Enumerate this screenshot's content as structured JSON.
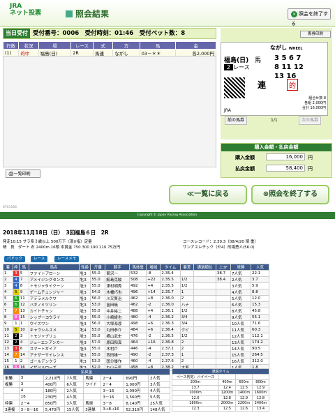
{
  "header": {
    "logo_line1": "JRA",
    "logo_line2": "ネット投票",
    "title": "照会結果",
    "end_label": "照会を終了する"
  },
  "status": {
    "tag": "当日受付",
    "text": "受付番号：0006　受付時刻：01:46　受付ベット数：8"
  },
  "table": {
    "headers": [
      "行数",
      "状況",
      "場",
      "名",
      "レース",
      "式",
      "別",
      "方",
      "式",
      "馬",
      "組",
      "金",
      "額"
    ],
    "row": {
      "num": "(1)",
      "status": "的中",
      "venue": "福島(日)",
      "race": "2R",
      "type": "馬連",
      "method": "ながし",
      "combo": "03－＊＊",
      "amount": "各2,000円"
    }
  },
  "print_link": "一覧印刷",
  "ticket": {
    "print": "馬券印刷",
    "venue": "福島",
    "day": "(日)",
    "race": "2",
    "race_label": "レース",
    "type": "ながし",
    "wheel": "WHEEL",
    "box_label": "馬",
    "nums": [
      "3",
      "5",
      "6",
      "7",
      "8",
      "11",
      "12",
      "13",
      "16"
    ],
    "ren": "連",
    "qr": "的",
    "jra": "JRA",
    "total_label": "組合せ数",
    "total": "8",
    "each": "各組",
    "each_amount": "2,000円",
    "sum_label": "合計",
    "sum_amount": "16,000円"
  },
  "nav": {
    "prev": "前の馬券",
    "page": "1/1",
    "next": "次の馬券"
  },
  "summary": {
    "title": "購入金額・払戻金額",
    "buy_label": "購入金額",
    "buy": "16,000",
    "pay_label": "払戻金額",
    "pay": "58,400",
    "unit": "円"
  },
  "back_label": "一覧に戻る",
  "end_label2": "照会を終了する",
  "copyright": "Copyright © Japan Racing Association.",
  "docnum": "0701504",
  "result": {
    "date": "2018年11月18日（日）　3回福島６日　2R",
    "meta1": "発走10:15 サラ系３歳以上 500万下（混)(指）定量",
    "meta2": "晴　良　ダート 右 2400m 16頭 本賞金 750 300 190 110 75万円",
    "course": "コースレコード：2.30.3（08/4/20 晴 重）",
    "record": "サンアスレチック（セ4）的場勇人(56.0)",
    "btns": [
      "パドック",
      "レース",
      "レースメモ"
    ],
    "headers": [
      "着",
      "枠",
      "馬",
      "馬名",
      "性齢",
      "斤量",
      "騎手",
      "馬体重",
      "増減",
      "タイム",
      "着差",
      "通過順位",
      "上3F",
      "単勝",
      "人気"
    ],
    "rows": [
      [
        "1",
        "3",
        "5",
        "ファイトアローン",
        "牡3",
        "55.0",
        "菊沢一",
        "532",
        "-8",
        "2.35.4",
        "",
        "",
        "38.7",
        "7人気",
        "22.1"
      ],
      [
        "2",
        "4",
        "7",
        "アメイジングセンス",
        "牝3",
        "55.0",
        "鮫島克駿",
        "508",
        "+22",
        "2.35.5",
        "1/2",
        "",
        "38.4",
        "2人気",
        "3.7"
      ],
      [
        "3",
        "4",
        "8",
        "トモジャタイクーン",
        "牡3",
        "55.0",
        "津村明秀",
        "492",
        "+4",
        "2.35.5",
        "1/2",
        "",
        "",
        "3人気",
        "5.9"
      ],
      [
        "4",
        "5",
        "9",
        "ゲームチェンジャー",
        "牡3",
        "54.0",
        "木幡巧也",
        "496",
        "+14",
        "2.35.7",
        "1",
        "",
        "",
        "4人気",
        "8.8"
      ],
      [
        "5",
        "6",
        "11",
        "アデラメルクワ",
        "牡3",
        "56.0",
        "川又賢治",
        "462",
        "+8",
        "2.36.0",
        "2",
        "",
        "",
        "5人気",
        "12.0"
      ],
      [
        "6",
        "6",
        "12",
        "ハギノミツリン",
        "牝3",
        "53.0",
        "富田暁",
        "462",
        "-2",
        "2.36.0",
        "ハナ",
        "",
        "",
        "6人気",
        "15.3"
      ],
      [
        "7",
        "7",
        "13",
        "カイトチャン",
        "牡3",
        "55.0",
        "中井裕二",
        "488",
        "+4",
        "2.36.1",
        "1/2",
        "",
        "",
        "8人気",
        "45.8"
      ],
      [
        "8",
        "8",
        "15",
        "シップーコウライ",
        "牡3",
        "55.0",
        "小崎綾也",
        "480",
        "-4",
        "2.36.2",
        "3/4",
        "",
        "",
        "9人気",
        "55.1"
      ],
      [
        "9",
        "1",
        "1",
        "ウイズワン",
        "牡3",
        "56.0",
        "大塚海渡",
        "498",
        "+6",
        "2.36.3",
        "3/4",
        "",
        "",
        "10人気",
        "71.6"
      ],
      [
        "10",
        "5",
        "10",
        "キャウシルスメ",
        "牝4",
        "53.0",
        "丸田恭介",
        "484",
        "+6",
        "2.36.4",
        "クビ",
        "",
        "",
        "11人気",
        "60.3"
      ],
      [
        "11",
        "2",
        "3",
        "トモジャプリュ",
        "牡3",
        "55.0",
        "横山武史",
        "476",
        "-2",
        "2.36.5",
        "1/2",
        "",
        "",
        "12人気",
        "112.1"
      ],
      [
        "12",
        "2",
        "4",
        "ジューエンアンカー",
        "牡3",
        "57.0",
        "原田和真",
        "464",
        "+16",
        "2.36.8",
        "2",
        "",
        "",
        "13人気",
        "174.2"
      ],
      [
        "13",
        "3",
        "6",
        "スマートガイア",
        "牡3",
        "55.0",
        "木村戸",
        "446",
        "-4",
        "2.37.1",
        "2",
        "",
        "",
        "14人気",
        "90.5"
      ],
      [
        "14",
        "7",
        "14",
        "アナザーサイレンス",
        "牡3",
        "55.0",
        "西田雄一",
        "490",
        "-2",
        "2.37.3",
        "1",
        "",
        "",
        "15人気",
        "264.5"
      ],
      [
        "15",
        "1",
        "2",
        "ゴールデンクラ",
        "牝3",
        "53.0",
        "国分優作",
        "460",
        "-4",
        "2.37.6",
        "2",
        "",
        "",
        "16人気",
        "312.0"
      ],
      [
        "16",
        "8",
        "16",
        "イザベルローズ",
        "牝3",
        "52.0",
        "丸山元気",
        "458",
        "+8",
        "2.38.2",
        "大差",
        "",
        "",
        "1人気",
        "1.8"
      ]
    ],
    "payout_title": "払戻金",
    "lap_title": "通過タイム",
    "payout": [
      [
        "単勝",
        "3",
        "2,210円",
        "7人気",
        "馬連",
        "2－4",
        "690円",
        "2人気"
      ],
      [
        "複勝",
        "3",
        "400円",
        "6人気",
        "ワイド",
        "2－4",
        "1,000円",
        "3人気"
      ],
      [
        "",
        "4",
        "180円",
        "2人気",
        "",
        "3－16",
        "1,090円",
        "4人気"
      ],
      [
        "",
        "16",
        "230円",
        "4人気",
        "",
        "3－16",
        "1,560円",
        "5人気"
      ],
      [
        "枠連",
        "2－4",
        "850円",
        "3人気",
        "馬単",
        "3－8",
        "8,140円",
        "25人気"
      ],
      [
        "3連複",
        "3－8－16",
        "5,470円",
        "15人気",
        "3連単",
        "3→8→16",
        "52,310円",
        "148人気"
      ]
    ],
    "lap": [
      [
        "ペース判定：ハイペース",
        "",
        "",
        ""
      ],
      [
        "200m",
        "400m",
        "600m",
        "800m"
      ],
      [
        "13.7",
        "12.4",
        "12.5",
        "12.9"
      ],
      [
        "1000m",
        "1200m",
        "1400m",
        "1600m"
      ],
      [
        "12.6",
        "12.8",
        "12.9",
        "12.8"
      ],
      [
        "1800m",
        "2000m",
        "2200m",
        "2400m"
      ],
      [
        "12.3",
        "12.5",
        "12.6",
        "13.4"
      ]
    ]
  }
}
